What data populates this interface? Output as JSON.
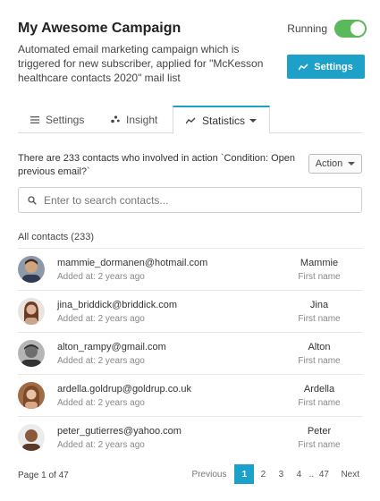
{
  "campaign": {
    "title": "My Awesome Campaign",
    "status_label": "Running",
    "description": "Automated email marketing campaign which is triggered for new subscriber, applied for \"McKesson healthcare contacts 2020\" mail list",
    "settings_button": "Settings"
  },
  "tabs": [
    {
      "label": "Settings",
      "icon": "list-icon"
    },
    {
      "label": "Insight",
      "icon": "scatter-icon"
    },
    {
      "label": "Statistics",
      "icon": "chart-line-icon",
      "active": true
    }
  ],
  "stats": {
    "info_text": "There are 233 contacts who involved in action `Condition: Open previous email?`",
    "action_button": "Action"
  },
  "search": {
    "placeholder": "Enter to search contacts..."
  },
  "contacts": {
    "heading": "All contacts (233)",
    "first_name_label": "First name",
    "items": [
      {
        "email": "mammie_dormanen@hotmail.com",
        "added": "Added at: 2 years ago",
        "first_name": "Mammie"
      },
      {
        "email": "jina_briddick@briddick.com",
        "added": "Added at: 2 years ago",
        "first_name": "Jina"
      },
      {
        "email": "alton_rampy@gmail.com",
        "added": "Added at: 2 years ago",
        "first_name": "Alton"
      },
      {
        "email": "ardella.goldrup@goldrup.co.uk",
        "added": "Added at: 2 years ago",
        "first_name": "Ardella"
      },
      {
        "email": "peter_gutierres@yahoo.com",
        "added": "Added at: 2 years ago",
        "first_name": "Peter"
      }
    ]
  },
  "pagination": {
    "info": "Page 1 of 47",
    "previous": "Previous",
    "next": "Next",
    "pages": [
      "1",
      "2",
      "3",
      "4",
      "..",
      "47"
    ],
    "current": "1"
  },
  "colors": {
    "accent": "#1da1c8",
    "toggle_on": "#5cb85c"
  }
}
